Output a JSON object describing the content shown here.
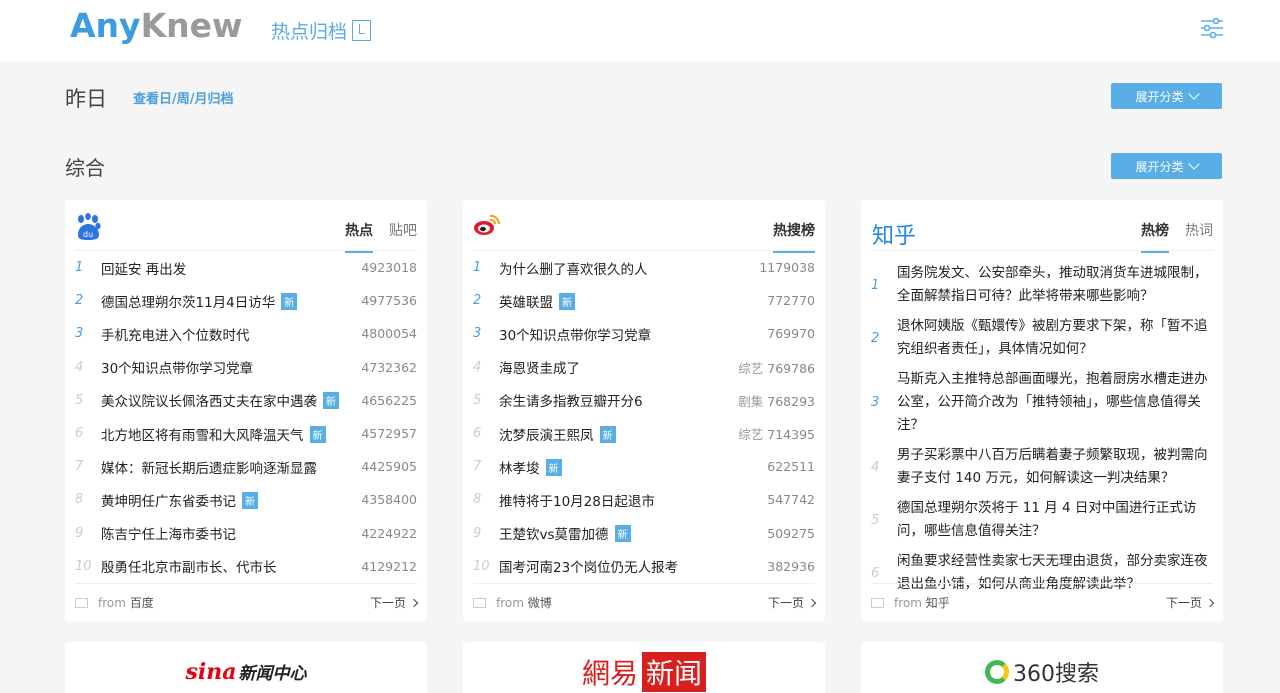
{
  "header": {
    "logo_prefix": "A",
    "logo_ny": "ny",
    "logo_k": "K",
    "logo_new": "new",
    "archive_link": "热点归档"
  },
  "day": {
    "label": "昨日",
    "archive_sub": "查看日/周/月归档",
    "expand": "展开分类"
  },
  "section": {
    "title": "综合",
    "expand": "展开分类"
  },
  "cards": [
    {
      "tabs": [
        "热点",
        "贴吧"
      ],
      "items": [
        {
          "rank": "1",
          "title": "回延安 再出发",
          "badge": "",
          "cat": "",
          "count": "4923018"
        },
        {
          "rank": "2",
          "title": "德国总理朔尔茨11月4日访华",
          "badge": "新",
          "cat": "",
          "count": "4977536"
        },
        {
          "rank": "3",
          "title": "手机充电进入个位数时代",
          "badge": "",
          "cat": "",
          "count": "4800054"
        },
        {
          "rank": "4",
          "title": "30个知识点带你学习党章",
          "badge": "",
          "cat": "",
          "count": "4732362"
        },
        {
          "rank": "5",
          "title": "美众议院议长佩洛西丈夫在家中遇袭",
          "badge": "新",
          "cat": "",
          "count": "4656225"
        },
        {
          "rank": "6",
          "title": "北方地区将有雨雪和大风降温天气",
          "badge": "新",
          "cat": "",
          "count": "4572957"
        },
        {
          "rank": "7",
          "title": "媒体：新冠长期后遗症影响逐渐显露",
          "badge": "",
          "cat": "",
          "count": "4425905"
        },
        {
          "rank": "8",
          "title": "黄坤明任广东省委书记",
          "badge": "新",
          "cat": "",
          "count": "4358400"
        },
        {
          "rank": "9",
          "title": "陈吉宁任上海市委书记",
          "badge": "",
          "cat": "",
          "count": "4224922"
        },
        {
          "rank": "10",
          "title": "殷勇任北京市副市长、代市长",
          "badge": "",
          "cat": "",
          "count": "4129212"
        }
      ],
      "from_prefix": "from",
      "from": "百度",
      "next": "下一页"
    },
    {
      "tabs": [
        "热搜榜"
      ],
      "items": [
        {
          "rank": "1",
          "title": "为什么删了喜欢很久的人",
          "badge": "",
          "cat": "",
          "count": "1179038"
        },
        {
          "rank": "2",
          "title": "英雄联盟",
          "badge": "新",
          "cat": "",
          "count": "772770"
        },
        {
          "rank": "3",
          "title": "30个知识点带你学习党章",
          "badge": "",
          "cat": "",
          "count": "769970"
        },
        {
          "rank": "4",
          "title": "海恩贤圭成了",
          "badge": "",
          "cat": "综艺",
          "count": "769786"
        },
        {
          "rank": "5",
          "title": "余生请多指教豆瓣开分6",
          "badge": "",
          "cat": "剧集",
          "count": "768293"
        },
        {
          "rank": "6",
          "title": "沈梦辰演王熙凤",
          "badge": "新",
          "cat": "综艺",
          "count": "714395"
        },
        {
          "rank": "7",
          "title": "林孝埈",
          "badge": "新",
          "cat": "",
          "count": "622511"
        },
        {
          "rank": "8",
          "title": "推特将于10月28日起退市",
          "badge": "",
          "cat": "",
          "count": "547742"
        },
        {
          "rank": "9",
          "title": "王楚钦vs莫雷加德",
          "badge": "新",
          "cat": "",
          "count": "509275"
        },
        {
          "rank": "10",
          "title": "国考河南23个岗位仍无人报考",
          "badge": "",
          "cat": "",
          "count": "382936"
        }
      ],
      "from_prefix": "from",
      "from": "微博",
      "next": "下一页"
    },
    {
      "brand": "知乎",
      "tabs": [
        "热榜",
        "热词"
      ],
      "items": [
        {
          "rank": "1",
          "title": "国务院发文、公安部牵头，推动取消货车进城限制，全面解禁指日可待？此举将带来哪些影响？"
        },
        {
          "rank": "2",
          "title": "退休阿姨版《甄嬛传》被剧方要求下架，称「暂不追究组织者责任」，具体情况如何？"
        },
        {
          "rank": "3",
          "title": "马斯克入主推特总部画面曝光，抱着厨房水槽走进办公室，公开简介改为「推特领袖」，哪些信息值得关注？"
        },
        {
          "rank": "4",
          "title": "男子买彩票中八百万后瞒着妻子频繁取现，被判需向妻子支付 140 万元，如何解读这一判决结果？"
        },
        {
          "rank": "5",
          "title": "德国总理朔尔茨将于 11 月 4 日对中国进行正式访问，哪些信息值得关注？"
        },
        {
          "rank": "6",
          "title": "闲鱼要求经营性卖家七天无理由退货，部分卖家连夜退出鱼小铺，如何从商业角度解读此举？"
        }
      ],
      "from_prefix": "from",
      "from": "知乎",
      "next": "下一页"
    }
  ],
  "brands": {
    "sina_a": "sina",
    "sina_b": "新闻中心",
    "netease_a": "網易",
    "netease_b": "新闻",
    "s360": "360搜索"
  },
  "colors": {
    "accent": "#5aaee8",
    "logo_blue": "#3d9be0"
  }
}
